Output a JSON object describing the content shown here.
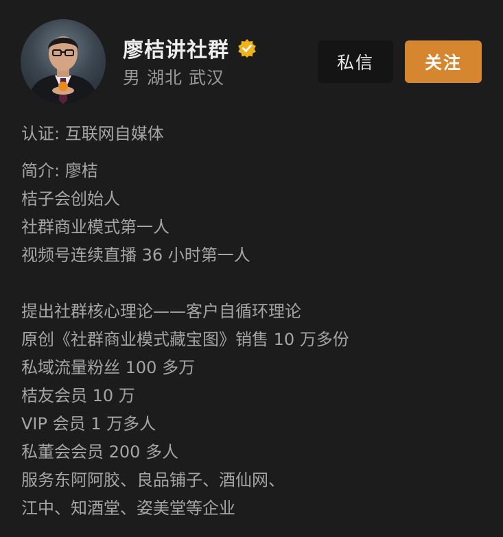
{
  "profile": {
    "name": "廖桔讲社群",
    "verified_icon": "verified-badge-icon",
    "accent_color": "#d6862f",
    "gender": "男",
    "province": "湖北",
    "city": "武汉",
    "message_label": "私信",
    "follow_label": "关注",
    "certification": "认证: 互联网自媒体"
  },
  "bio": {
    "lines": [
      "简介: 廖桔",
      "桔子会创始人",
      "社群商业模式第一人",
      "视频号连续直播 36 小时第一人",
      "",
      "提出社群核心理论——客户自循环理论",
      "原创《社群商业模式藏宝图》销售 10 万多份",
      "私域流量粉丝 100 多万",
      "桔友会员 10 万",
      "VIP 会员 1 万多人",
      "私董会会员 200 多人",
      "服务东阿阿胶、良品铺子、酒仙网、",
      "江中、知酒堂、姿美堂等企业"
    ]
  }
}
